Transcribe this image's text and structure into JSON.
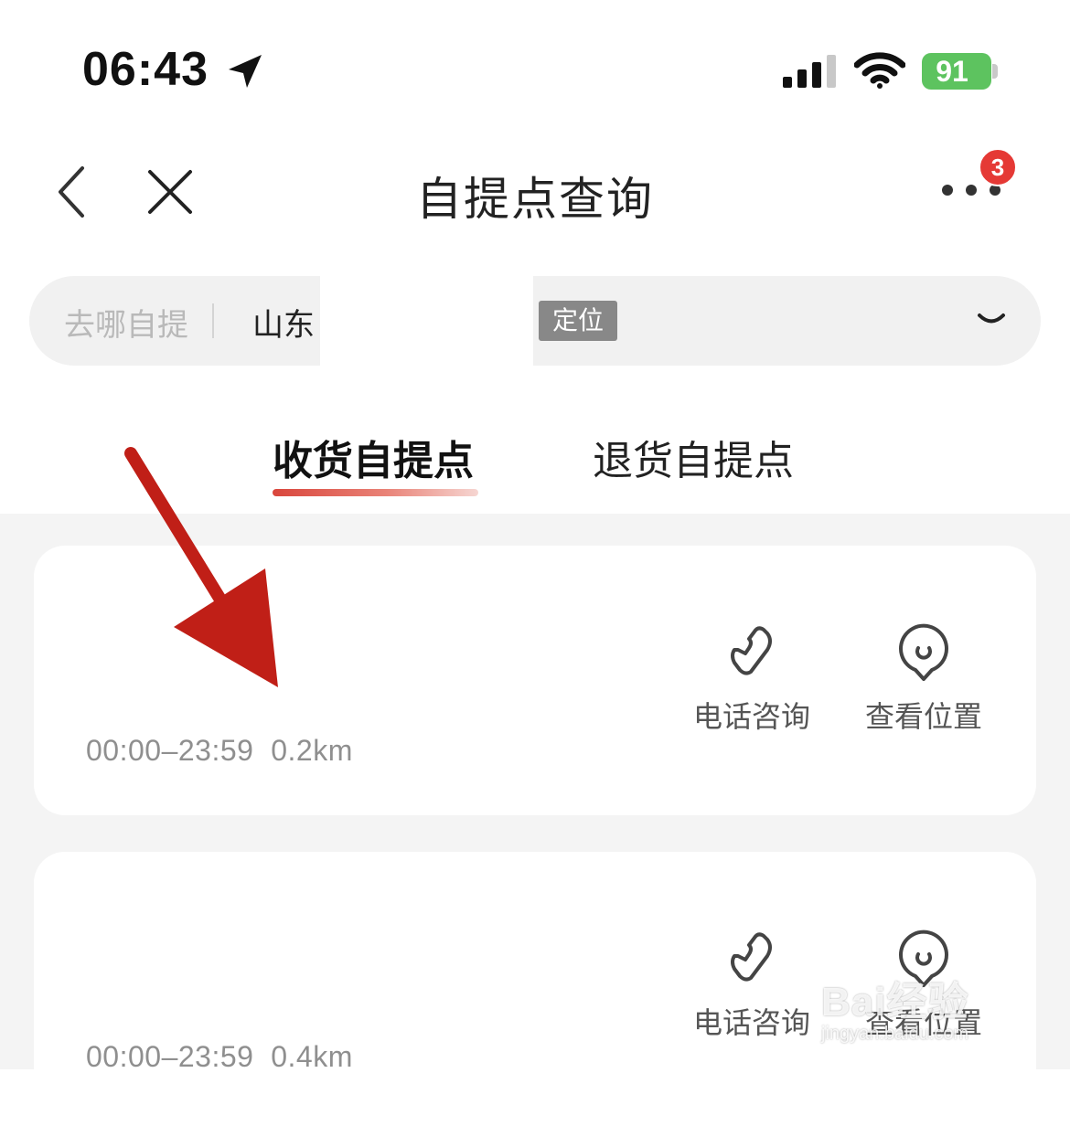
{
  "status_bar": {
    "time": "06:43",
    "battery": "91",
    "icons": [
      "location-arrow-icon",
      "cellular-signal-icon",
      "wifi-icon",
      "battery-charging-icon"
    ]
  },
  "nav": {
    "title": "自提点查询",
    "back_icon": "chevron-left-icon",
    "close_icon": "close-icon",
    "more_icon": "more-dots-icon",
    "badge_count": "3"
  },
  "search": {
    "label": "去哪自提",
    "value": "山东",
    "locate_button": "定位",
    "dropdown_icon": "chevron-down-icon"
  },
  "tabs": [
    {
      "label": "收货自提点",
      "active": true
    },
    {
      "label": "退货自提点",
      "active": false
    }
  ],
  "pickup_points": [
    {
      "hours": "00:00–23:59",
      "distance": "0.2km",
      "call_label": "电话咨询",
      "location_label": "查看位置"
    },
    {
      "hours": "00:00–23:59",
      "distance": "0.4km",
      "call_label": "电话咨询",
      "location_label": "查看位置"
    }
  ],
  "watermark": {
    "brand": "Bai经验",
    "url": "jingyan.baidu.com"
  },
  "colors": {
    "accent": "#d9463c",
    "badge": "#e53935",
    "battery": "#5dc35f",
    "annotation_arrow": "#c01f17"
  }
}
